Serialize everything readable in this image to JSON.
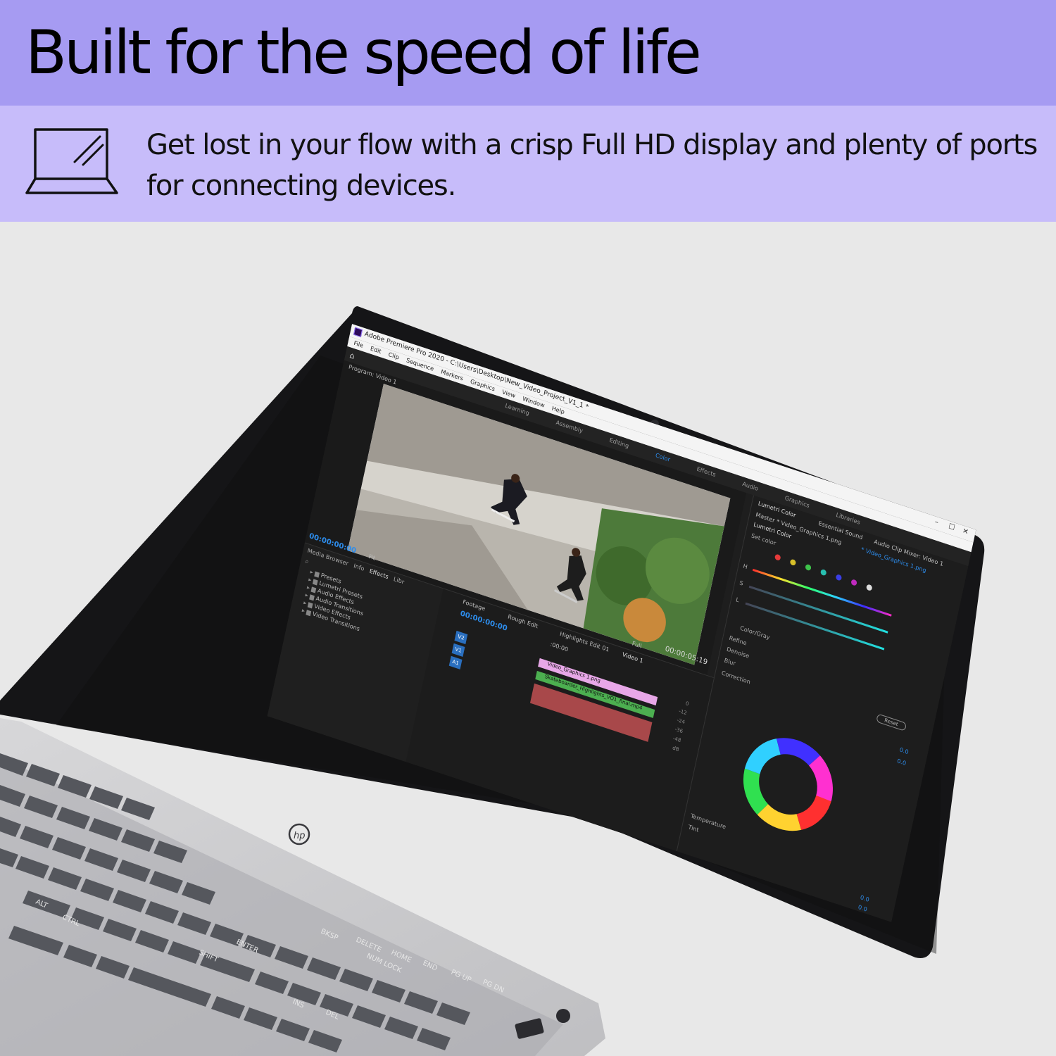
{
  "banner": {
    "headline": "Built for the speed of life",
    "description": "Get lost in your flow with a crisp Full HD display and plenty of ports for connecting devices.",
    "icon": "laptop-display-icon",
    "colors": {
      "header": "#a69bf2",
      "subheader": "#c7bcfa",
      "background": "#e8e8e8"
    }
  },
  "laptop": {
    "brand_logo": "hp",
    "app": {
      "title": "Adobe Premiere Pro 2020 - C:\\Users\\Desktop\\New_Video_Project_V1_1 *",
      "menu": [
        "File",
        "Edit",
        "Clip",
        "Sequence",
        "Markers",
        "Graphics",
        "View",
        "Window",
        "Help"
      ],
      "workspaces": [
        "Learning",
        "Assembly",
        "Editing",
        "Color",
        "Effects",
        "Audio",
        "Graphics",
        "Libraries"
      ],
      "active_workspace": "Color",
      "program_monitor": {
        "label": "Program: Video 1",
        "timecode_start": "00:00:00:00",
        "timecode_end": "00:00:05:19",
        "fit": "Fit",
        "resolution": "Full"
      },
      "project_panel": {
        "tabs": [
          "Media Browser",
          "Info",
          "Effects",
          "Libr"
        ],
        "items": [
          "Presets",
          "Lumetri Presets",
          "Audio Effects",
          "Audio Transitions",
          "Video Effects",
          "Video Transitions"
        ]
      },
      "timeline": {
        "tabs": [
          "Footage",
          "Rough Edit",
          "Highlights Edit 01",
          "Video 1"
        ],
        "timecode": "00:00:00:00",
        "ruler_start": ":00:00",
        "tracks": [
          "V2",
          "V1",
          "A1"
        ],
        "clips": [
          "Video_Graphics 1.png",
          "Skateboarder_Highlights_VO1_final.mp4"
        ],
        "meter_ticks": [
          "0",
          "-12",
          "-24",
          "-36",
          "-48",
          "dB"
        ]
      },
      "lumetri": {
        "tabs": [
          "Lumetri Color",
          "Essential Sound",
          "Audio Clip Mixer: Video 1"
        ],
        "source": "Master * Video_Graphics 1.png",
        "target": "* Video_Graphics 1.png",
        "section": "Lumetri Color",
        "set_color": "Set color",
        "channels": [
          "H",
          "S",
          "L"
        ],
        "checkbox": "Color/Gray",
        "controls": [
          "Refine",
          "Denoise",
          "Blur",
          "Correction"
        ],
        "reset": "Reset",
        "values": [
          "0.0",
          "0.0"
        ],
        "wheel_controls": [
          "Temperature",
          "Tint"
        ],
        "wheel_values": [
          "0.0",
          "0.0"
        ]
      }
    },
    "keyboard_keys": [
      "ALT",
      "CTRL",
      "SHIFT",
      "ENTER",
      "BKSP",
      "DELETE",
      "HOME",
      "END",
      "PG UP",
      "PG DN",
      "INS",
      "DEL",
      "NUM LOCK"
    ]
  }
}
